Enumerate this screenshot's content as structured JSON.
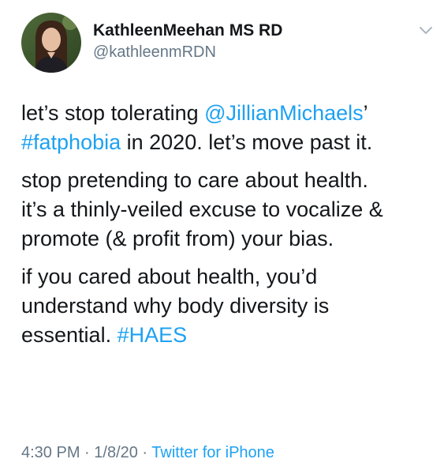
{
  "user": {
    "display_name": "KathleenMeehan MS RD",
    "handle": "@kathleenmRDN"
  },
  "tweet": {
    "p1": {
      "mention": "@JillianMichaels",
      "after_mention": "’",
      "before_mention": "let’s stop tolerating ",
      "hashtag": "#fatphobia",
      "after_hashtag": " in 2020. let’s move past it."
    },
    "p2": {
      "line1": "stop pretending to care about health.",
      "line2": "it’s a thinly-veiled excuse to vocalize &",
      "line3": "promote (& profit from) your bias."
    },
    "p3": {
      "line1": "if you cared about health, you’d",
      "line2": "understand why body diversity is",
      "line3_text": "essential. ",
      "hashtag": "#HAES"
    }
  },
  "meta": {
    "time": "4:30 PM",
    "separator1": " · ",
    "date": "1/8/20",
    "separator2": " · ",
    "source": "Twitter for iPhone"
  },
  "icons": {
    "menu": "chevron-down-icon"
  },
  "colors": {
    "link": "#1da1f2",
    "secondary_text": "#657786",
    "primary_text": "#14171a"
  }
}
